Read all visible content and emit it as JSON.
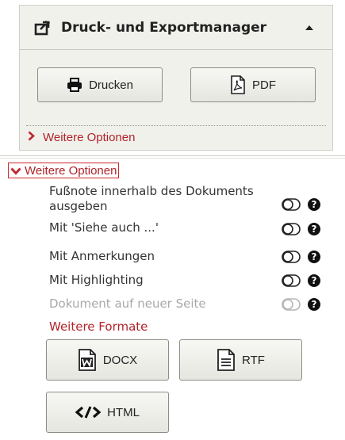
{
  "manager": {
    "title": "Druck- und Exportmanager",
    "buttons": {
      "print": "Drucken",
      "pdf": "PDF"
    },
    "more_options_collapsed": "Weitere Optionen"
  },
  "options": {
    "toggle_label": "Weitere Optionen",
    "items": [
      {
        "label": "Fußnote innerhalb des Dokuments ausgeben",
        "enabled": true
      },
      {
        "label": "Mit 'Siehe auch ...'",
        "enabled": true
      },
      {
        "label": "Mit Anmerkungen",
        "enabled": true
      },
      {
        "label": "Mit Highlighting",
        "enabled": true
      },
      {
        "label": "Dokument auf neuer Seite",
        "enabled": false
      }
    ],
    "help_glyph": "?",
    "more_formats": "Weitere Formate",
    "formats": {
      "docx": "DOCX",
      "rtf": "RTF",
      "html": "HTML"
    }
  },
  "colors": {
    "accent_red": "#b0232a",
    "panel_bg": "#f1f1ec",
    "disabled_text": "#a9a9a9"
  }
}
